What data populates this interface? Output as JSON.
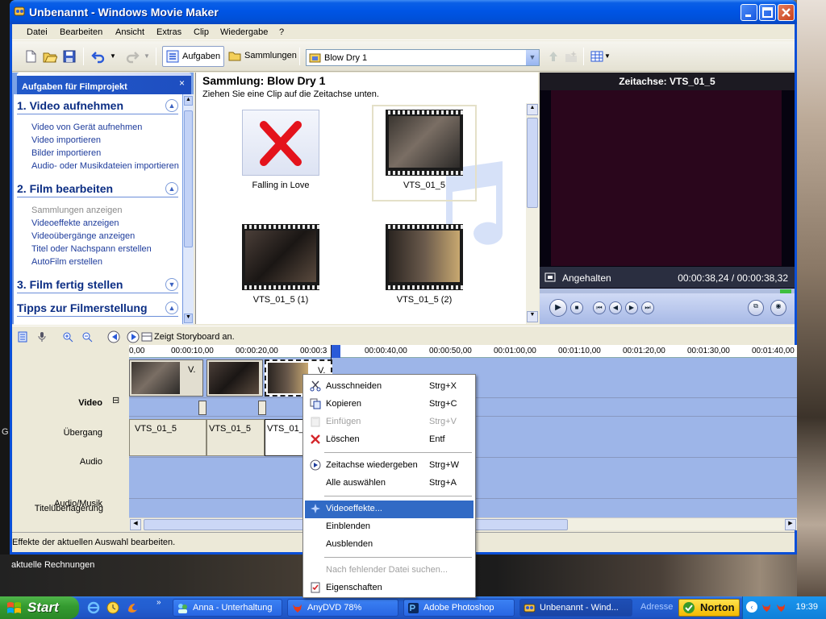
{
  "desktop": {
    "label": "aktuelle Rechnungen",
    "fragment": "G"
  },
  "window": {
    "title": "Unbenannt - Windows Movie Maker"
  },
  "menu": [
    "Datei",
    "Bearbeiten",
    "Ansicht",
    "Extras",
    "Clip",
    "Wiedergabe",
    "?"
  ],
  "toolbar": {
    "tasks_label": "Aufgaben",
    "collections_label": "Sammlungen",
    "collection_value": "Blow Dry 1"
  },
  "taskpane": {
    "header": "Aufgaben für Filmprojekt",
    "close": "×",
    "sections": [
      {
        "title": "1. Video aufnehmen",
        "items": [
          {
            "label": "Video von Gerät aufnehmen",
            "disabled": false
          },
          {
            "label": "Video importieren",
            "disabled": false
          },
          {
            "label": "Bilder importieren",
            "disabled": false
          },
          {
            "label": "Audio- oder Musikdateien importieren",
            "disabled": false
          }
        ]
      },
      {
        "title": "2. Film bearbeiten",
        "items": [
          {
            "label": "Sammlungen anzeigen",
            "disabled": true
          },
          {
            "label": "Videoeffekte anzeigen",
            "disabled": false
          },
          {
            "label": "Videoübergänge anzeigen",
            "disabled": false
          },
          {
            "label": "Titel oder Nachspann erstellen",
            "disabled": false
          },
          {
            "label": "AutoFilm erstellen",
            "disabled": false
          }
        ]
      },
      {
        "title": "3. Film fertig stellen",
        "items": []
      },
      {
        "title": "Tipps zur Filmerstellung",
        "items": []
      }
    ]
  },
  "collection": {
    "title": "Sammlung: Blow Dry 1",
    "subtitle": "Ziehen Sie eine Clip auf die Zeitachse unten.",
    "clips": [
      {
        "label": "Falling in Love",
        "missing": true
      },
      {
        "label": "VTS_01_5",
        "missing": false,
        "selected": true
      },
      {
        "label": "VTS_01_5 (1)",
        "missing": false
      },
      {
        "label": "VTS_01_5 (2)",
        "missing": false
      }
    ]
  },
  "monitor": {
    "title": "Zeitachse: VTS_01_5",
    "state": "Angehalten",
    "time": "00:00:38,24 / 00:00:38,32"
  },
  "timeline": {
    "storyboard_label": "Zeigt Storyboard an.",
    "ruler": [
      "0,00",
      "00:00:10,00",
      "00:00:20,00",
      "00:00:3",
      "00:00:40,00",
      "00:00:50,00",
      "00:01:00,00",
      "00:01:10,00",
      "00:01:20,00",
      "00:01:30,00",
      "00:01:40,00"
    ],
    "tracks": {
      "video": "Video",
      "collapse": "⊟",
      "transition": "Übergang",
      "audio": "Audio",
      "music": "Audio/Musik",
      "title": "Titelüberlagerung"
    },
    "video_clip_tag": "V.",
    "audio_clips": [
      "VTS_01_5",
      "VTS_01_5",
      "VTS_01_5"
    ]
  },
  "context_menu": {
    "items": [
      {
        "label": "Ausschneiden",
        "shortcut": "Strg+X",
        "icon": "scissors-icon",
        "disabled": false
      },
      {
        "label": "Kopieren",
        "shortcut": "Strg+C",
        "icon": "copy-icon",
        "disabled": false
      },
      {
        "label": "Einfügen",
        "shortcut": "Strg+V",
        "icon": "paste-icon",
        "disabled": true
      },
      {
        "label": "Löschen",
        "shortcut": "Entf",
        "icon": "delete-icon",
        "disabled": false
      },
      {
        "label": "Zeitachse wiedergeben",
        "shortcut": "Strg+W",
        "icon": "play-icon",
        "disabled": false
      },
      {
        "label": "Alle auswählen",
        "shortcut": "Strg+A",
        "icon": "",
        "disabled": false
      },
      {
        "label": "Videoeffekte...",
        "shortcut": "",
        "icon": "effects-icon",
        "disabled": false,
        "selected": true
      },
      {
        "label": "Einblenden",
        "shortcut": "",
        "icon": "",
        "disabled": false
      },
      {
        "label": "Ausblenden",
        "shortcut": "",
        "icon": "",
        "disabled": false
      },
      {
        "label": "Nach fehlender Datei suchen...",
        "shortcut": "",
        "icon": "",
        "disabled": true
      },
      {
        "label": "Eigenschaften",
        "shortcut": "",
        "icon": "properties-icon",
        "disabled": false
      }
    ]
  },
  "statusbar": {
    "text": "Effekte der aktuellen Auswahl bearbeiten."
  },
  "taskbar": {
    "start": "Start",
    "tasks": [
      {
        "label": "Anna - Unterhaltung",
        "icon": "chat-icon",
        "active": false
      },
      {
        "label": "AnyDVD 78%",
        "icon": "fox-icon",
        "active": false
      },
      {
        "label": "Adobe Photoshop",
        "icon": "photoshop-icon",
        "active": false
      },
      {
        "label": "Unbenannt - Wind...",
        "icon": "moviemaker-icon",
        "active": true
      }
    ],
    "address_label": "Adresse",
    "norton": "Norton",
    "clock": "19:39"
  }
}
